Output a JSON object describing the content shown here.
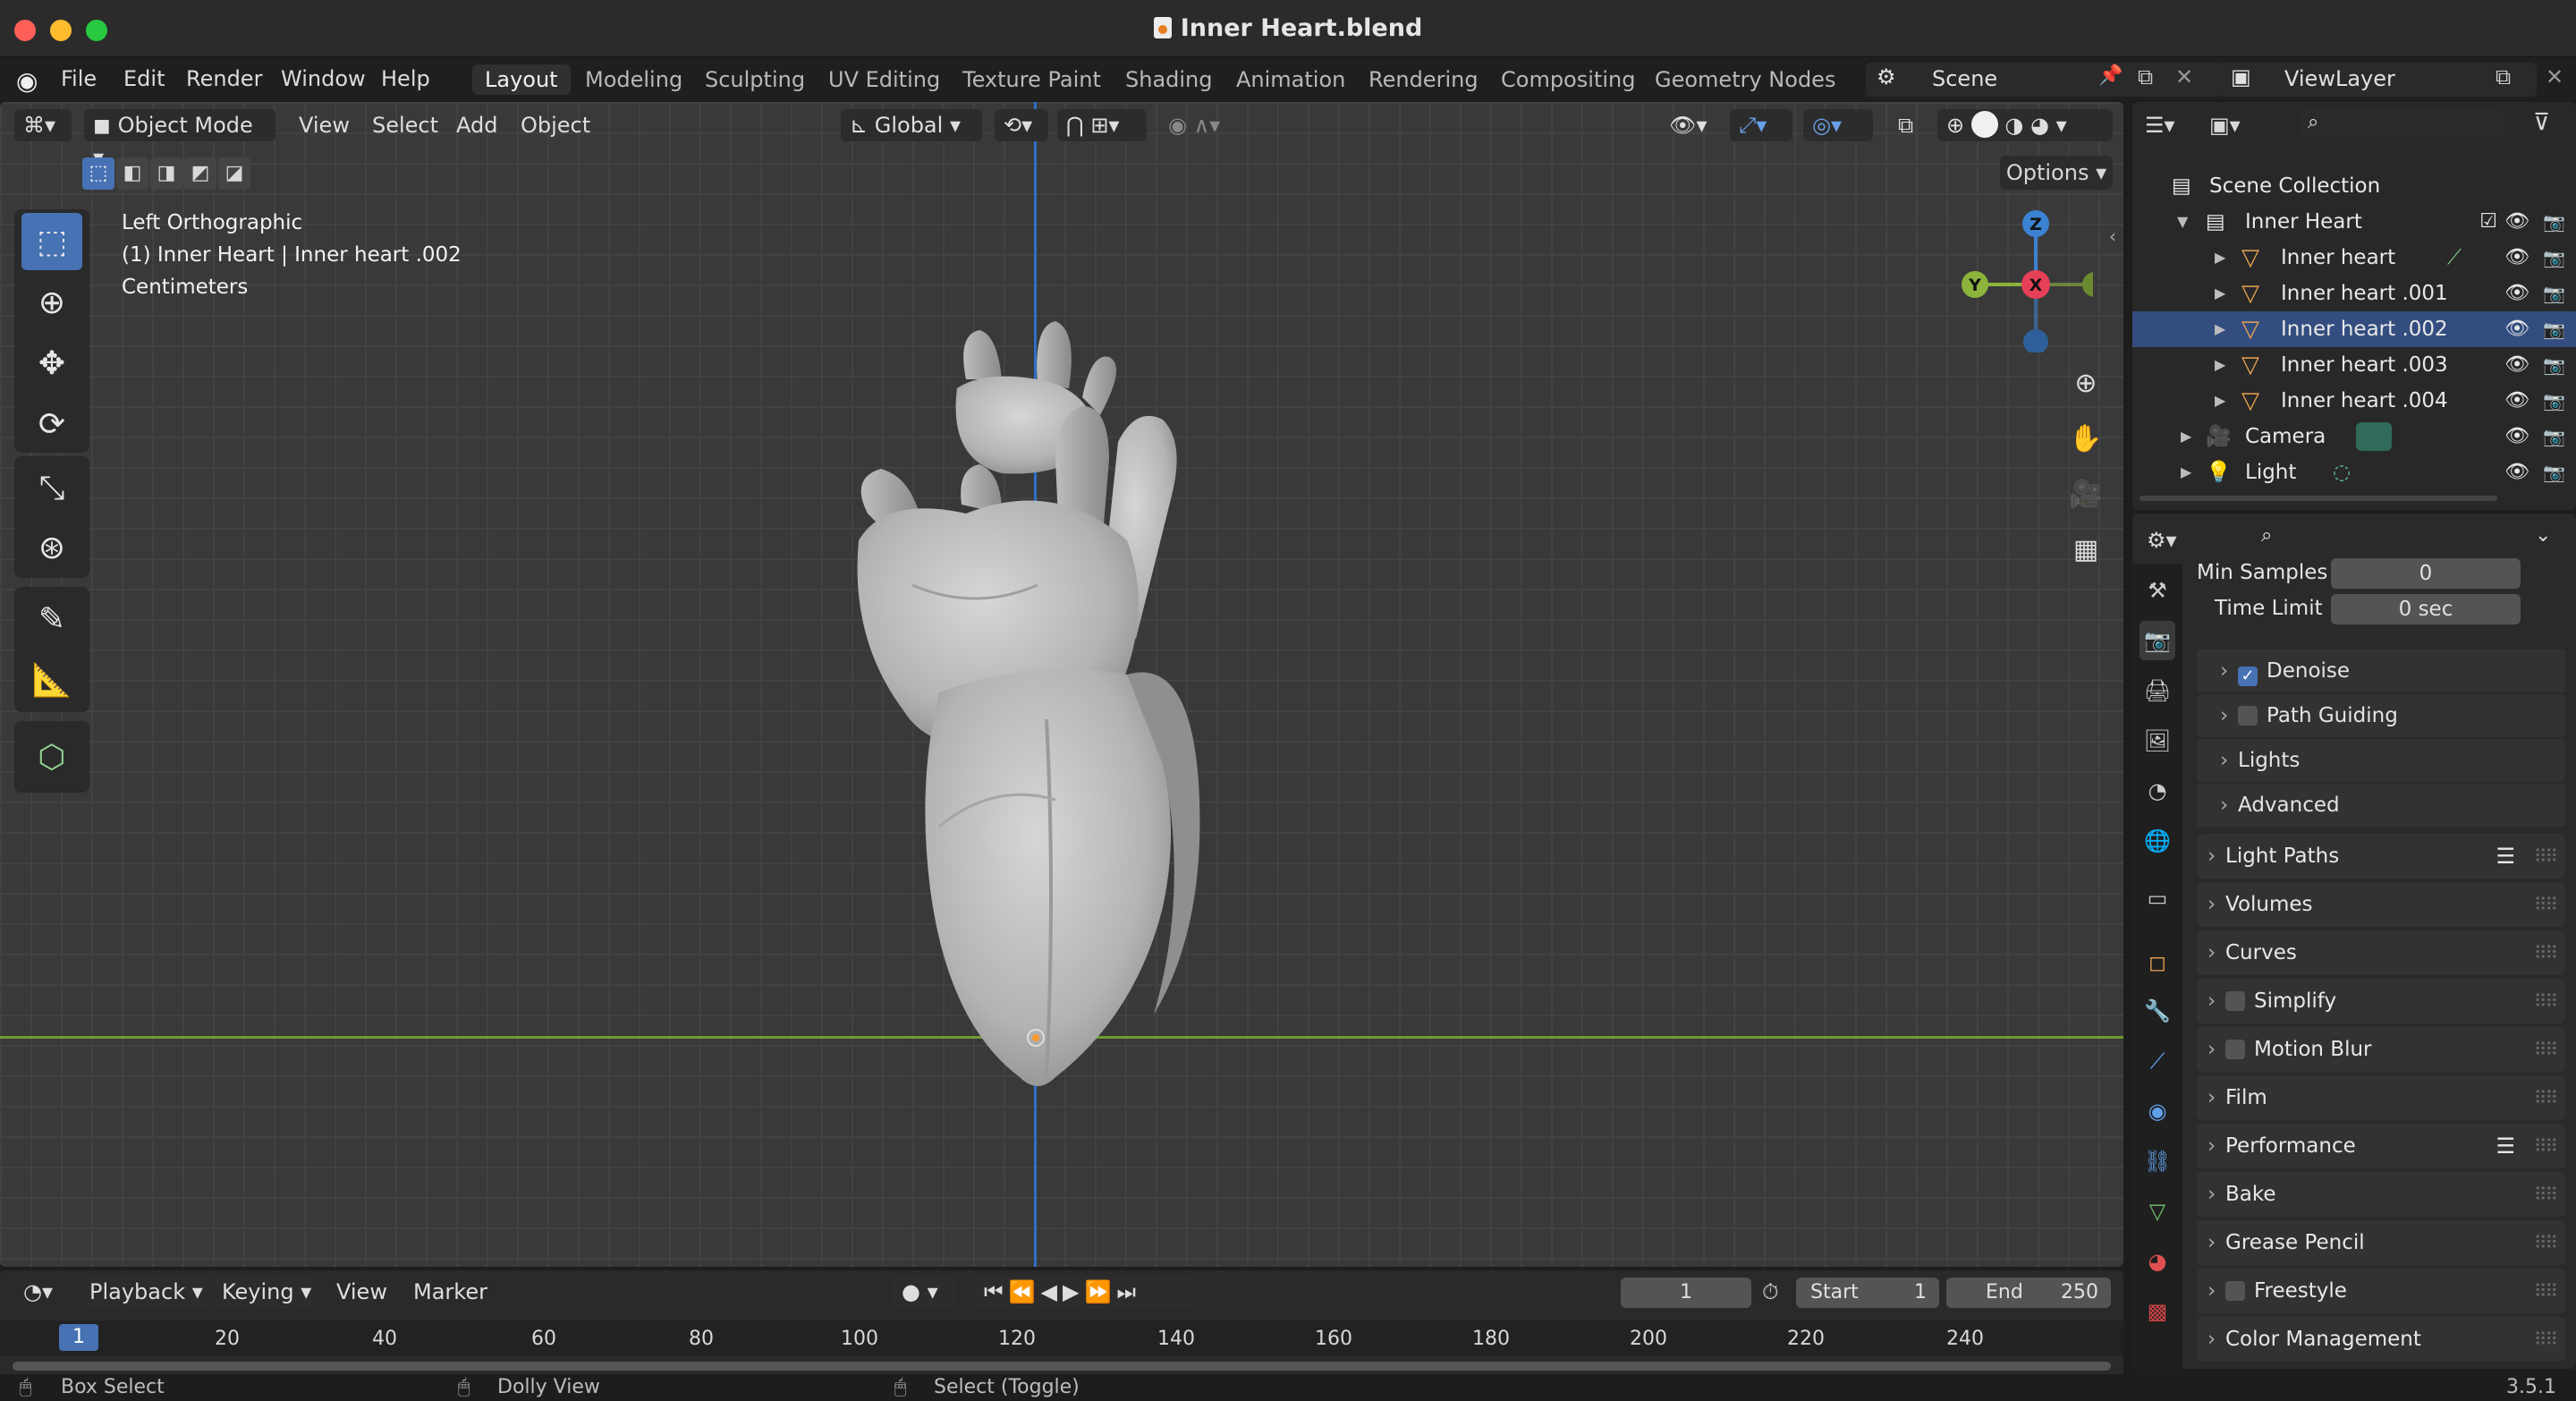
{
  "window": {
    "title": "Inner Heart.blend"
  },
  "menu": [
    "File",
    "Edit",
    "Render",
    "Window",
    "Help"
  ],
  "workspaces": [
    "Layout",
    "Modeling",
    "Sculpting",
    "UV Editing",
    "Texture Paint",
    "Shading",
    "Animation",
    "Rendering",
    "Compositing",
    "Geometry Nodes"
  ],
  "scene": {
    "name": "Scene",
    "view_layer": "ViewLayer"
  },
  "viewport": {
    "mode": "Object Mode",
    "menus": [
      "View",
      "Select",
      "Add",
      "Object"
    ],
    "orientation": "Global",
    "options_label": "Options",
    "info": {
      "view": "Left Orthographic",
      "object": "(1) Inner Heart | Inner heart .002",
      "units": "Centimeters"
    },
    "gizmo": {
      "z": "Z",
      "y": "Y",
      "x": "X"
    }
  },
  "outliner": {
    "root": "Scene Collection",
    "collection": "Inner Heart",
    "objects": [
      "Inner heart",
      "Inner heart .001",
      "Inner heart .002",
      "Inner heart .003",
      "Inner heart .004"
    ],
    "selected": "Inner heart .002",
    "camera": "Camera",
    "light": "Light"
  },
  "properties": {
    "min_samples": {
      "label": "Min Samples",
      "value": "0"
    },
    "time_limit": {
      "label": "Time Limit",
      "value": "0 sec"
    },
    "subpanels": [
      "Denoise",
      "Path Guiding",
      "Lights",
      "Advanced"
    ],
    "panels": [
      "Light Paths",
      "Volumes",
      "Curves",
      "Simplify",
      "Motion Blur",
      "Film",
      "Performance",
      "Bake",
      "Grease Pencil",
      "Freestyle",
      "Color Management"
    ]
  },
  "timeline": {
    "menus": [
      "Playback",
      "Keying",
      "View",
      "Marker"
    ],
    "current_frame": "1",
    "start_label": "Start",
    "start": "1",
    "end_label": "End",
    "end": "250",
    "ruler": [
      "1",
      "20",
      "40",
      "60",
      "80",
      "100",
      "120",
      "140",
      "160",
      "180",
      "200",
      "220",
      "240"
    ]
  },
  "status": {
    "left": "Box Select",
    "middle": "Dolly View",
    "right": "Select (Toggle)",
    "version": "3.5.1"
  },
  "colors": {
    "accent": "#4772b3",
    "selection": "#334d80",
    "mesh_icon": "#e8a250",
    "x_axis": "#e64058",
    "y_axis": "#8cb43c",
    "z_axis": "#3c82d2"
  }
}
